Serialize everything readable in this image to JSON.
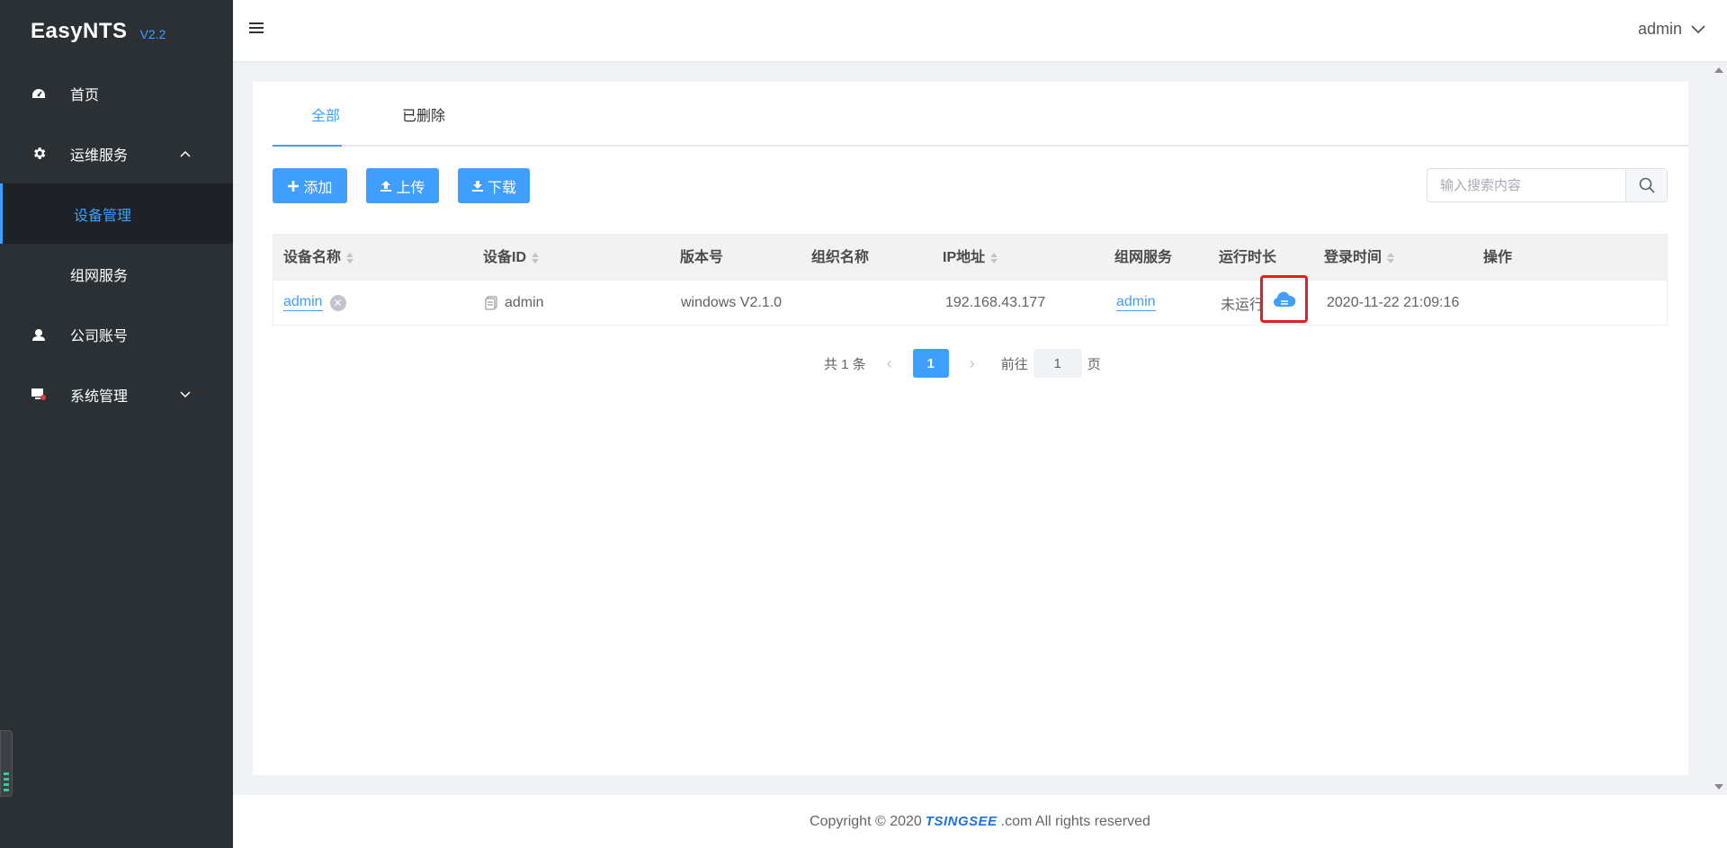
{
  "app": {
    "name": "EasyNTS",
    "version": "V2.2"
  },
  "sidebar": {
    "items": [
      {
        "label": "首页",
        "icon": "dashboard-icon"
      },
      {
        "label": "运维服务",
        "icon": "gear-icon",
        "expanded": true
      },
      {
        "label": "设备管理",
        "sub": true,
        "active": true
      },
      {
        "label": "组网服务",
        "sub": true
      },
      {
        "label": "公司账号",
        "icon": "user-icon"
      },
      {
        "label": "系统管理",
        "icon": "monitor-icon",
        "expanded": false
      }
    ]
  },
  "header": {
    "user": "admin"
  },
  "tabs": [
    {
      "label": "全部",
      "active": true
    },
    {
      "label": "已删除"
    }
  ],
  "toolbar": {
    "add_label": "添加",
    "upload_label": "上传",
    "download_label": "下载"
  },
  "search": {
    "placeholder": "输入搜索内容",
    "value": ""
  },
  "table": {
    "columns": [
      "设备名称",
      "设备ID",
      "版本号",
      "组织名称",
      "IP地址",
      "组网服务",
      "运行时长",
      "登录时间",
      "操作"
    ],
    "rows": [
      {
        "name": "admin",
        "device_id": "admin",
        "version": "windows V2.1.0",
        "org": "",
        "ip": "192.168.43.177",
        "service": "admin",
        "uptime": "未运行",
        "login_time": "2020-11-22 21:09:16"
      }
    ]
  },
  "pagination": {
    "total_text": "共 1 条",
    "current": "1",
    "goto_label": "前往",
    "goto_value": "1",
    "page_suffix": "页"
  },
  "footer": {
    "prefix": "Copyright © 2020",
    "brand": "TSINGSEE",
    "suffix": ".com All rights reserved"
  },
  "colors": {
    "accent": "#409eff",
    "sidebar_bg": "#2b3035",
    "highlight_border": "#e02020"
  }
}
